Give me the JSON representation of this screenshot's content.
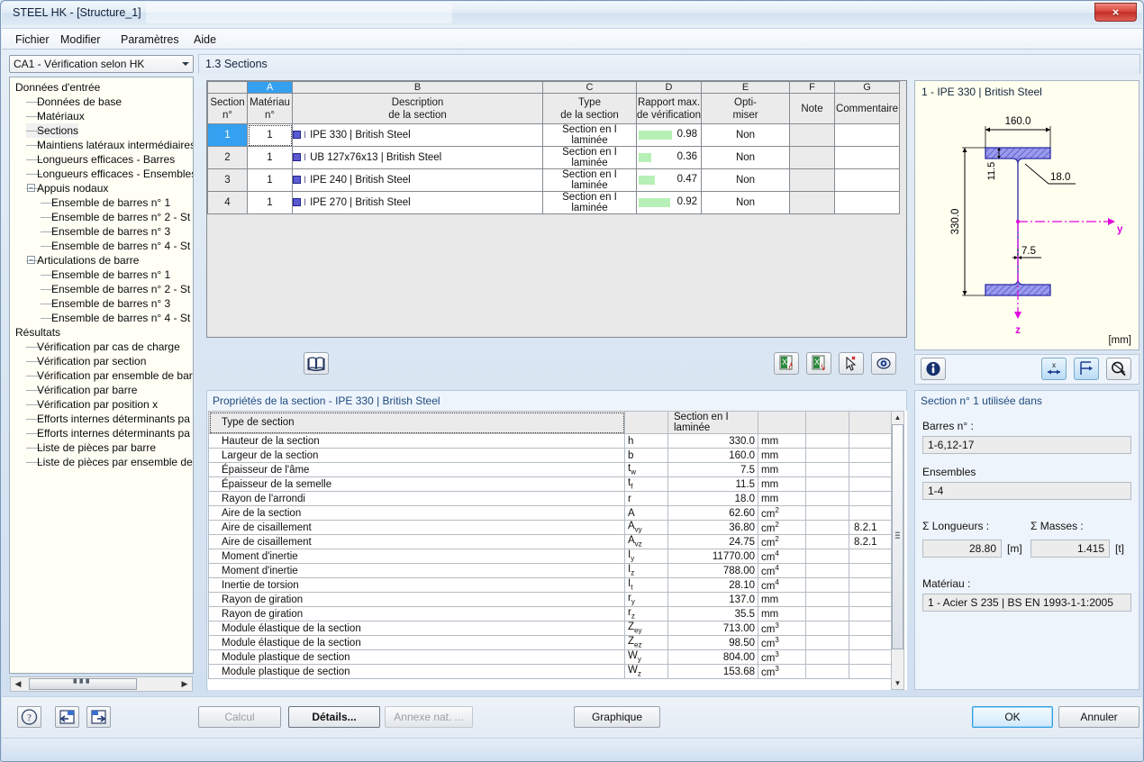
{
  "window": {
    "title": "STEEL HK - [Structure_1]",
    "close_label": "×"
  },
  "menu": {
    "items": [
      "Fichier",
      "Modifier",
      "Paramètres",
      "Aide"
    ]
  },
  "toolbar_top": {
    "combo_value": "CA1 - Vérification selon HK",
    "section_header": "1.3 Sections"
  },
  "sidebar": {
    "items": [
      {
        "label": "Données d'entrée",
        "level": 0,
        "type": "root"
      },
      {
        "label": "Données de base",
        "level": 1,
        "type": "leaf"
      },
      {
        "label": "Matériaux",
        "level": 1,
        "type": "leaf"
      },
      {
        "label": "Sections",
        "level": 1,
        "type": "leaf",
        "selected": true
      },
      {
        "label": "Maintiens latéraux intermédiaires",
        "level": 1,
        "type": "leaf"
      },
      {
        "label": "Longueurs efficaces - Barres",
        "level": 1,
        "type": "leaf"
      },
      {
        "label": "Longueurs efficaces - Ensembles",
        "level": 1,
        "type": "leaf"
      },
      {
        "label": "Appuis nodaux",
        "level": 1,
        "type": "group"
      },
      {
        "label": "Ensemble de barres n° 1",
        "level": 2,
        "type": "leaf"
      },
      {
        "label": "Ensemble de barres n° 2 - St",
        "level": 2,
        "type": "leaf"
      },
      {
        "label": "Ensemble de barres n° 3",
        "level": 2,
        "type": "leaf"
      },
      {
        "label": "Ensemble de barres n° 4 - St",
        "level": 2,
        "type": "leaf"
      },
      {
        "label": "Articulations de barre",
        "level": 1,
        "type": "group"
      },
      {
        "label": "Ensemble de barres n° 1",
        "level": 2,
        "type": "leaf"
      },
      {
        "label": "Ensemble de barres n° 2 - St",
        "level": 2,
        "type": "leaf"
      },
      {
        "label": "Ensemble de barres n° 3",
        "level": 2,
        "type": "leaf"
      },
      {
        "label": "Ensemble de barres n° 4 - St",
        "level": 2,
        "type": "leaf"
      },
      {
        "label": "Résultats",
        "level": 0,
        "type": "root"
      },
      {
        "label": "Vérification par cas de charge",
        "level": 1,
        "type": "leaf"
      },
      {
        "label": "Vérification par section",
        "level": 1,
        "type": "leaf"
      },
      {
        "label": "Vérification par ensemble de bar",
        "level": 1,
        "type": "leaf"
      },
      {
        "label": "Vérification par barre",
        "level": 1,
        "type": "leaf"
      },
      {
        "label": "Vérification par position x",
        "level": 1,
        "type": "leaf"
      },
      {
        "label": "Efforts internes déterminants pa",
        "level": 1,
        "type": "leaf"
      },
      {
        "label": "Efforts internes déterminants pa",
        "level": 1,
        "type": "leaf"
      },
      {
        "label": "Liste de pièces par barre",
        "level": 1,
        "type": "leaf"
      },
      {
        "label": "Liste de pièces  par ensemble de",
        "level": 1,
        "type": "leaf"
      }
    ]
  },
  "sections_table": {
    "column_letters": [
      "",
      "A",
      "B",
      "C",
      "D",
      "E",
      "F",
      "G"
    ],
    "active_column": "A",
    "headers": [
      {
        "l1": "Section",
        "l2": "n°"
      },
      {
        "l1": "Matériau",
        "l2": "n°"
      },
      {
        "l1": "Description",
        "l2": "de la section"
      },
      {
        "l1": "Type",
        "l2": "de la section"
      },
      {
        "l1": "Rapport max.",
        "l2": "de vérification"
      },
      {
        "l1": "Opti-",
        "l2": "miser"
      },
      {
        "l1": "",
        "l2": "Note"
      },
      {
        "l1": "",
        "l2": "Commentaire"
      }
    ],
    "rows": [
      {
        "section": "1",
        "materiau": "1",
        "description": "IPE 330 | British Steel",
        "type": "Section en I laminée",
        "ratio": "0.98",
        "ratio_pct": 98,
        "optimiser": "Non",
        "note": "",
        "commentaire": "",
        "selected": true
      },
      {
        "section": "2",
        "materiau": "1",
        "description": "UB 127x76x13 | British Steel",
        "type": "Section en I laminée",
        "ratio": "0.36",
        "ratio_pct": 36,
        "optimiser": "Non",
        "note": "",
        "commentaire": "",
        "selected": false
      },
      {
        "section": "3",
        "materiau": "1",
        "description": "IPE 240 | British Steel",
        "type": "Section en I laminée",
        "ratio": "0.47",
        "ratio_pct": 47,
        "optimiser": "Non",
        "note": "",
        "commentaire": "",
        "selected": false
      },
      {
        "section": "4",
        "materiau": "1",
        "description": "IPE 270 | British Steel",
        "type": "Section en I laminée",
        "ratio": "0.92",
        "ratio_pct": 92,
        "optimiser": "Non",
        "note": "",
        "commentaire": "",
        "selected": false
      }
    ],
    "ratio_bar_color": "#b6f0b6"
  },
  "mid_toolbar": {
    "buttons": [
      {
        "name": "library-icon",
        "title": "Bibliothèque"
      },
      {
        "name": "export-excel-up-icon",
        "title": "Exporter vers Excel"
      },
      {
        "name": "import-excel-down-icon",
        "title": "Importer depuis Excel"
      },
      {
        "name": "select-pick-icon",
        "title": "Sélectionner"
      },
      {
        "name": "view-eye-icon",
        "title": "Visualiser"
      }
    ]
  },
  "properties": {
    "title": "Propriétés de la section  -  IPE 330 | British Steel",
    "rows": [
      {
        "label": "Type de section",
        "symbol": "",
        "sym_sub": "",
        "value": "Section en I laminée",
        "unit": "",
        "unit_sup": "",
        "note": "",
        "is_header": true
      },
      {
        "label": "Hauteur de la section",
        "symbol": "h",
        "sym_sub": "",
        "value": "330.0",
        "unit": "mm",
        "unit_sup": "",
        "note": ""
      },
      {
        "label": "Largeur de la section",
        "symbol": "b",
        "sym_sub": "",
        "value": "160.0",
        "unit": "mm",
        "unit_sup": "",
        "note": ""
      },
      {
        "label": "Épaisseur de l'âme",
        "symbol": "t",
        "sym_sub": "w",
        "value": "7.5",
        "unit": "mm",
        "unit_sup": "",
        "note": ""
      },
      {
        "label": "Épaisseur de la semelle",
        "symbol": "t",
        "sym_sub": "f",
        "value": "11.5",
        "unit": "mm",
        "unit_sup": "",
        "note": ""
      },
      {
        "label": "Rayon de l'arrondi",
        "symbol": "r",
        "sym_sub": "",
        "value": "18.0",
        "unit": "mm",
        "unit_sup": "",
        "note": ""
      },
      {
        "label": "Aire de la section",
        "symbol": "A",
        "sym_sub": "",
        "value": "62.60",
        "unit": "cm",
        "unit_sup": "2",
        "note": ""
      },
      {
        "label": "Aire de cisaillement",
        "symbol": "A",
        "sym_sub": "vy",
        "value": "36.80",
        "unit": "cm",
        "unit_sup": "2",
        "note": "8.2.1"
      },
      {
        "label": "Aire de cisaillement",
        "symbol": "A",
        "sym_sub": "vz",
        "value": "24.75",
        "unit": "cm",
        "unit_sup": "2",
        "note": "8.2.1"
      },
      {
        "label": "Moment d'inertie",
        "symbol": "I",
        "sym_sub": "y",
        "value": "11770.00",
        "unit": "cm",
        "unit_sup": "4",
        "note": ""
      },
      {
        "label": "Moment d'inertie",
        "symbol": "I",
        "sym_sub": "z",
        "value": "788.00",
        "unit": "cm",
        "unit_sup": "4",
        "note": ""
      },
      {
        "label": "Inertie de torsion",
        "symbol": "I",
        "sym_sub": "t",
        "value": "28.10",
        "unit": "cm",
        "unit_sup": "4",
        "note": ""
      },
      {
        "label": "Rayon de giration",
        "symbol": "r",
        "sym_sub": "y",
        "value": "137.0",
        "unit": "mm",
        "unit_sup": "",
        "note": ""
      },
      {
        "label": "Rayon de giration",
        "symbol": "r",
        "sym_sub": "z",
        "value": "35.5",
        "unit": "mm",
        "unit_sup": "",
        "note": ""
      },
      {
        "label": "Module élastique de la section",
        "symbol": "Z",
        "sym_sub": "ey",
        "value": "713.00",
        "unit": "cm",
        "unit_sup": "3",
        "note": ""
      },
      {
        "label": "Module élastique de la section",
        "symbol": "Z",
        "sym_sub": "ez",
        "value": "98.50",
        "unit": "cm",
        "unit_sup": "3",
        "note": ""
      },
      {
        "label": "Module plastique de section",
        "symbol": "W",
        "sym_sub": "y",
        "value": "804.00",
        "unit": "cm",
        "unit_sup": "3",
        "note": ""
      },
      {
        "label": "Module plastique de section",
        "symbol": "W",
        "sym_sub": "z",
        "value": "153.68",
        "unit": "cm",
        "unit_sup": "3",
        "note": ""
      }
    ]
  },
  "graphics": {
    "title": "1 - IPE 330 | British Steel",
    "unit_label": "[mm]",
    "dim_width": "160.0",
    "dim_height": "330.0",
    "dim_flange": "11.5",
    "dim_radius": "18.0",
    "dim_web": "7.5",
    "axis_y": "y",
    "axis_z": "z",
    "section_color": "#8f8fe8",
    "axis_color": "#e000e0"
  },
  "graphics_toolbar": {
    "buttons": [
      {
        "name": "info-icon",
        "title": "Informations"
      },
      {
        "name": "dimension-x-icon",
        "title": "Dimensions"
      },
      {
        "name": "axes-icon",
        "title": "Axes"
      },
      {
        "name": "zoom-reset-icon",
        "title": "Réinitialiser le zoom"
      }
    ]
  },
  "info_panel": {
    "title": "Section n° 1 utilisée dans",
    "bars_label": "Barres n° :",
    "bars_value": "1-6,12-17",
    "sets_label": "Ensembles",
    "sets_value": "1-4",
    "lengths_label": "Σ  Longueurs :",
    "lengths_value": "28.80",
    "lengths_unit": "[m]",
    "masses_label": "Σ  Masses :",
    "masses_value": "1.415",
    "masses_unit": "[t]",
    "material_label": "Matériau :",
    "material_value": "1 - Acier S 235 | BS EN 1993-1-1:2005"
  },
  "bottom_bar": {
    "help_icon": "help-icon",
    "prev_icon": "prev-panel-icon",
    "next_icon": "next-panel-icon",
    "calcul": "Calcul",
    "details": "Détails...",
    "annexe": "Annexe nat. ...",
    "graphique": "Graphique",
    "ok": "OK",
    "annuler": "Annuler"
  }
}
